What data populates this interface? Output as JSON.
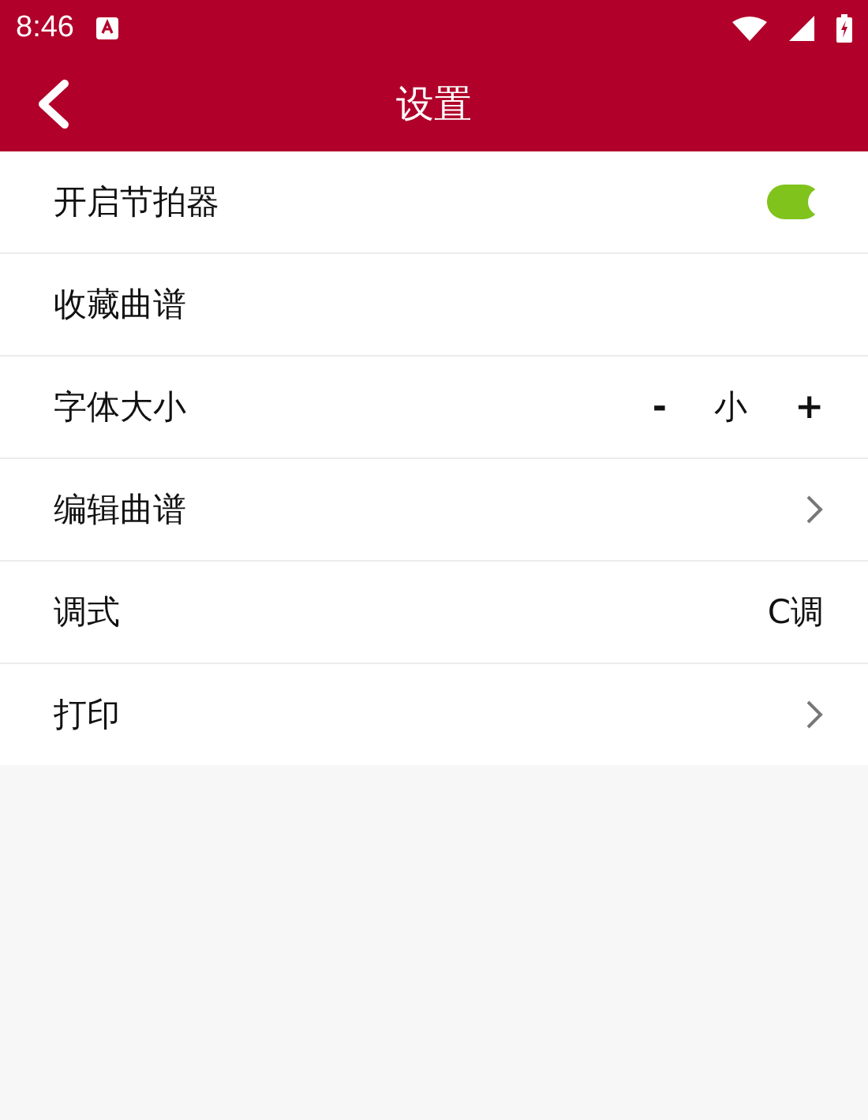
{
  "status_bar": {
    "time": "8:46"
  },
  "toolbar": {
    "title": "设置"
  },
  "settings": [
    {
      "kind": "toggle",
      "label": "开启节拍器",
      "on": true
    },
    {
      "kind": "plain",
      "label": "收藏曲谱"
    },
    {
      "kind": "stepper",
      "label": "字体大小",
      "minus": "-",
      "value": "小",
      "plus": "+"
    },
    {
      "kind": "link",
      "label": "编辑曲谱"
    },
    {
      "kind": "value",
      "label": "调式",
      "value": "C调"
    },
    {
      "kind": "link",
      "label": "打印"
    }
  ]
}
